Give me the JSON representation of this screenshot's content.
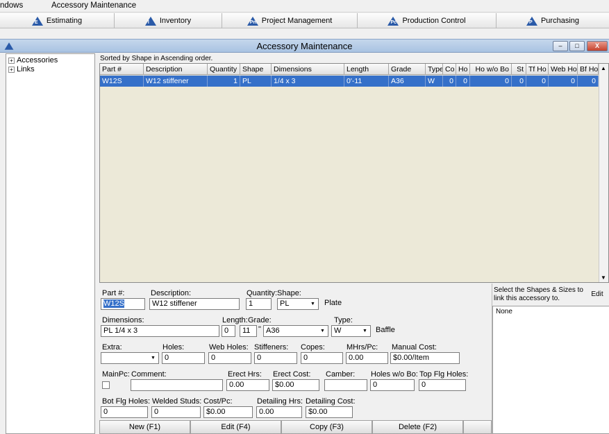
{
  "menubar": {
    "windows": "ndows",
    "current": "Accessory Maintenance"
  },
  "modules": [
    {
      "label": "Estimating",
      "icon": "E"
    },
    {
      "label": "Inventory",
      "icon": "I"
    },
    {
      "label": "Project Management",
      "icon": "Pm"
    },
    {
      "label": "Production Control",
      "icon": "Pc"
    },
    {
      "label": "Purchasing",
      "icon": "P"
    }
  ],
  "window": {
    "title": "Accessory Maintenance",
    "min": "–",
    "max": "□",
    "close": "X"
  },
  "tree": {
    "items": [
      "Accessories",
      "Links"
    ],
    "expander": "+"
  },
  "grid": {
    "sorted_text": "Sorted by Shape in Ascending order.",
    "headers": [
      "Part #",
      "Description",
      "Quantity",
      "Shape",
      "Dimensions",
      "Length",
      "Grade",
      "Type",
      "Co",
      "Ho",
      "Ho w/o Bo",
      "St",
      "Tf Ho",
      "Web Ho",
      "Bf Ho"
    ],
    "rows": [
      [
        "W12S",
        "W12 stiffener",
        "1",
        "PL",
        "1/4 x 3",
        "0'-11",
        "A36",
        "W",
        "0",
        "0",
        "0",
        "0",
        "0",
        "0",
        "0"
      ]
    ]
  },
  "form": {
    "part_label": "Part #:",
    "part_value": "W12S",
    "desc_label": "Description:",
    "desc_value": "W12 stiffener",
    "qty_label": "Quantity:",
    "qty_value": "1",
    "shape_label": "Shape:",
    "shape_value": "PL",
    "shape_desc": "Plate",
    "dim_label": "Dimensions:",
    "dim_value": "PL 1/4 x 3",
    "length_label": "Length:",
    "length_ft": "0",
    "length_in": "11",
    "ft_mark": "'",
    "in_mark": "\"",
    "grade_label": "Grade:",
    "grade_value": "A36",
    "type_label": "Type:",
    "type_value": "W",
    "type_desc": "Baffle",
    "extra_label": "Extra:",
    "extra_value": "",
    "holes_label": "Holes:",
    "holes_value": "0",
    "webholes_label": "Web Holes:",
    "webholes_value": "0",
    "stiffeners_label": "Stiffeners:",
    "stiffeners_value": "0",
    "copes_label": "Copes:",
    "copes_value": "0",
    "mhrs_label": "MHrs/Pc:",
    "mhrs_value": "0.00",
    "manualcost_label": "Manual Cost:",
    "manualcost_value": "$0.00/Item",
    "mainpc_label": "MainPc:",
    "comment_label": "Comment:",
    "comment_value": "",
    "erecthrs_label": "Erect Hrs:",
    "erecthrs_value": "0.00",
    "erectcost_label": "Erect Cost:",
    "erectcost_value": "$0.00",
    "camber_label": "Camber:",
    "camber_value": "",
    "holeswobo_label": "Holes w/o Bo:",
    "holeswobo_value": "0",
    "topflg_label": "Top Flg Holes:",
    "topflg_value": "0",
    "botflg_label": "Bot Flg Holes:",
    "botflg_value": "0",
    "weldstuds_label": "Welded Studs:",
    "weldstuds_value": "0",
    "costpc_label": "Cost/Pc:",
    "costpc_value": "$0.00",
    "detailhrs_label": "Detailing Hrs:",
    "detailhrs_value": "0.00",
    "detailcost_label": "Detailing Cost:",
    "detailcost_value": "$0.00"
  },
  "shapes": {
    "prompt": "Select the Shapes & Sizes to link this accessory to.",
    "edit_label": "Edit",
    "list": [
      "None"
    ]
  },
  "actions": [
    "New (F1)",
    "Edit (F4)",
    "Copy (F3)",
    "Delete (F2)"
  ]
}
